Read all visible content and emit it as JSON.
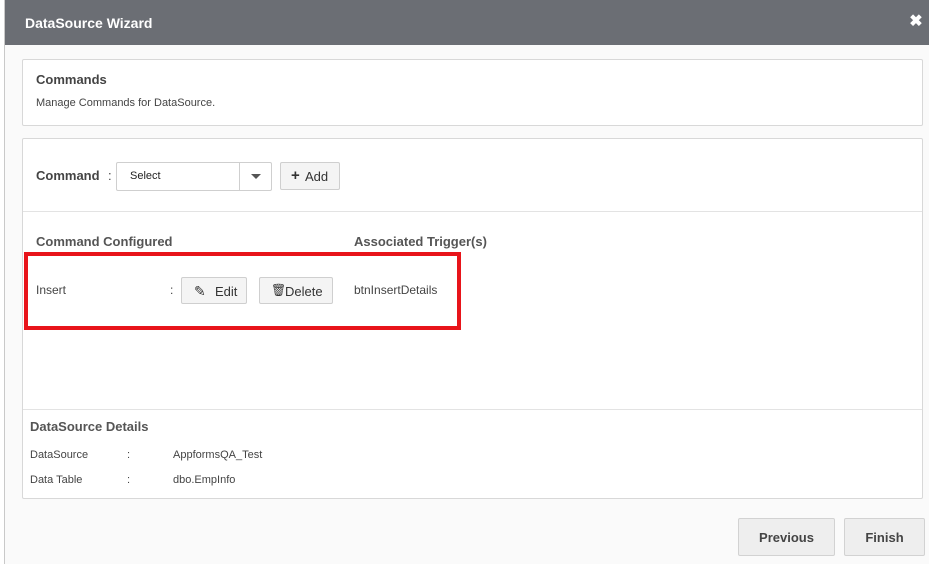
{
  "window": {
    "title": "DataSource Wizard",
    "close_icon": "✖"
  },
  "commands_panel": {
    "title": "Commands",
    "subtitle": "Manage Commands for DataSource."
  },
  "command_bar": {
    "label": "Command",
    "colon": ":",
    "select_value": "Select",
    "add_label": "Add"
  },
  "table": {
    "headers": {
      "command": "Command Configured",
      "trigger": "Associated Trigger(s)"
    },
    "rows": [
      {
        "command": "Insert",
        "colon": ":",
        "edit_label": "Edit",
        "delete_label": "Delete",
        "trigger": "btnInsertDetails"
      }
    ]
  },
  "datasource_details": {
    "title": "DataSource Details",
    "items": [
      {
        "label": "DataSource",
        "colon": ":",
        "value": "AppformsQA_Test"
      },
      {
        "label": "Data Table",
        "colon": ":",
        "value": "dbo.EmpInfo"
      }
    ]
  },
  "footer": {
    "previous_label": "Previous",
    "finish_label": "Finish"
  },
  "colors": {
    "titlebar": "#6b6e74",
    "highlight": "#e8141a"
  }
}
